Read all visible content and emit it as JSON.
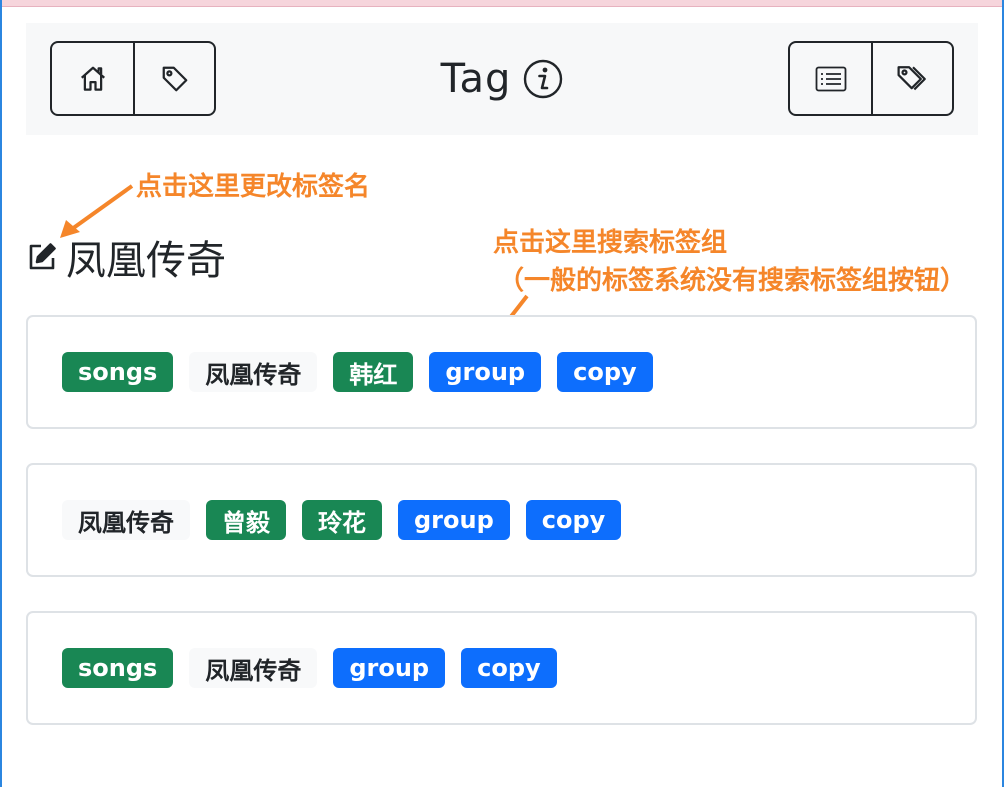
{
  "navbar": {
    "title": "Tag",
    "left_buttons": [
      {
        "icon": "home-icon"
      },
      {
        "icon": "tag-icon"
      }
    ],
    "right_buttons": [
      {
        "icon": "list-icon"
      },
      {
        "icon": "tag-icon"
      }
    ],
    "info_icon": "info-icon"
  },
  "tag": {
    "name": "凤凰传奇",
    "edit_icon": "edit-icon"
  },
  "annotations": {
    "rename_note": "点击这里更改标签名",
    "search_note_line1": "点击这里搜索标签组",
    "search_note_line2": "（一般的标签系统没有搜索标签组按钮）"
  },
  "groups": [
    {
      "tags": [
        {
          "label": "songs",
          "style": "green"
        },
        {
          "label": "凤凰传奇",
          "style": "light"
        },
        {
          "label": "韩红",
          "style": "green"
        },
        {
          "label": "group",
          "style": "blue"
        },
        {
          "label": "copy",
          "style": "blue"
        }
      ]
    },
    {
      "tags": [
        {
          "label": "凤凰传奇",
          "style": "light"
        },
        {
          "label": "曾毅",
          "style": "green"
        },
        {
          "label": "玲花",
          "style": "green"
        },
        {
          "label": "group",
          "style": "blue"
        },
        {
          "label": "copy",
          "style": "blue"
        }
      ]
    },
    {
      "tags": [
        {
          "label": "songs",
          "style": "green"
        },
        {
          "label": "凤凰传奇",
          "style": "light"
        },
        {
          "label": "group",
          "style": "blue"
        },
        {
          "label": "copy",
          "style": "blue"
        }
      ]
    }
  ],
  "colors": {
    "green": "#198754",
    "blue": "#0d6efd",
    "light": "#f8f9fa",
    "annotation": "#f5862a"
  }
}
